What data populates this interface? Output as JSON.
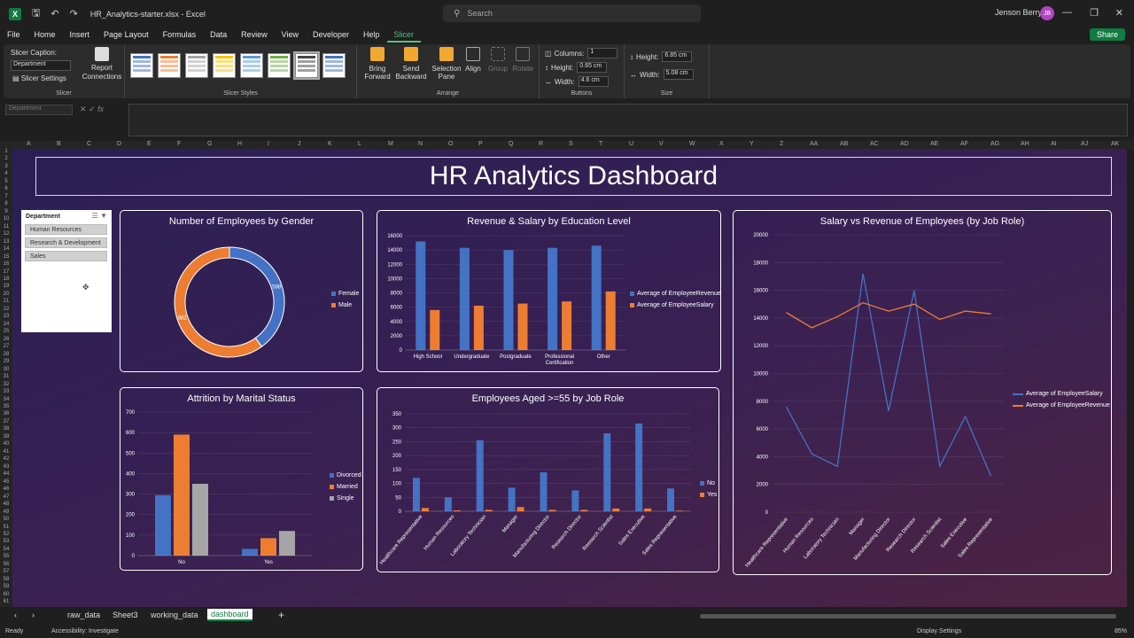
{
  "window": {
    "doc_title": "HR_Analytics-starter.xlsx  -  Excel",
    "search_placeholder": "Search",
    "user_name": "Jenson Berry",
    "user_initials": "JB"
  },
  "menu": [
    "File",
    "Home",
    "Insert",
    "Page Layout",
    "Formulas",
    "Data",
    "Review",
    "View",
    "Developer",
    "Help",
    "Slicer"
  ],
  "share_label": "Share",
  "ribbon": {
    "slicer_caption_label": "Slicer Caption:",
    "slicer_caption_value": "Department",
    "slicer_settings_label": "Slicer Settings",
    "report_connections_label": "Report Connections",
    "group_slicer": "Slicer",
    "group_styles": "Slicer Styles",
    "bring_forward": "Bring Forward",
    "send_backward": "Send Backward",
    "selection_pane": "Selection Pane",
    "align": "Align",
    "group": "Group",
    "rotate": "Rotate",
    "group_arrange": "Arrange",
    "columns_label": "Columns:",
    "columns_value": "1",
    "btn_height_label": "Height:",
    "btn_height_value": "0.65 cm",
    "btn_width_label": "Width:",
    "btn_width_value": "4.6 cm",
    "group_buttons": "Buttons",
    "size_height_label": "Height:",
    "size_height_value": "6.85 cm",
    "size_width_label": "Width:",
    "size_width_value": "5.08 cm",
    "group_size": "Size"
  },
  "formula": {
    "name_box": "Department",
    "fx": "fx"
  },
  "columns": [
    "A",
    "B",
    "C",
    "D",
    "E",
    "F",
    "G",
    "H",
    "I",
    "J",
    "K",
    "L",
    "M",
    "N",
    "O",
    "P",
    "Q",
    "R",
    "S",
    "T",
    "U",
    "V",
    "W",
    "X",
    "Y",
    "Z",
    "AA",
    "AB",
    "AC",
    "AD",
    "AE",
    "AF",
    "AG",
    "AH",
    "AI",
    "AJ",
    "AK"
  ],
  "dashboard": {
    "title": "HR Analytics Dashboard"
  },
  "slicer": {
    "title": "Department",
    "items": [
      "Human Resources",
      "Research & Development",
      "Sales"
    ]
  },
  "colors": {
    "blue": "#4472c4",
    "orange": "#ed7d31",
    "gray": "#a5a5a5",
    "excel_green": "#107c41"
  },
  "chart_data": [
    {
      "type": "pie",
      "title": "Number of Employees by Gender",
      "categories": [
        "Female",
        "Male"
      ],
      "values": [
        588,
        882
      ],
      "data_labels": [
        "588",
        "882"
      ]
    },
    {
      "type": "bar",
      "title": "Revenue & Salary by Education Level",
      "categories": [
        "High School",
        "Undergraduate",
        "Postgraduate",
        "Professional Certification",
        "Other"
      ],
      "series": [
        {
          "name": "Average of EmployeeRevenue",
          "values": [
            15200,
            14300,
            14000,
            14300,
            14600
          ]
        },
        {
          "name": "Average of EmployeeSalary",
          "values": [
            5600,
            6200,
            6500,
            6800,
            8200
          ]
        }
      ],
      "ylim": [
        0,
        16000
      ],
      "yticks": [
        "0",
        "2000",
        "4000",
        "6000",
        "8000",
        "10000",
        "12000",
        "14000",
        "16000"
      ]
    },
    {
      "type": "line",
      "title": "Salary vs Revenue of Employees (by Job Role)",
      "categories": [
        "Healthcare Representative",
        "Human Resources",
        "Laboratory Technician",
        "Manager",
        "Manufacturing Director",
        "Research Director",
        "Research Scientist",
        "Sales Executive",
        "Sales Representative"
      ],
      "series": [
        {
          "name": "Average of EmployeeSalary",
          "values": [
            7600,
            4200,
            3300,
            17200,
            7300,
            16000,
            3300,
            6900,
            2600
          ]
        },
        {
          "name": "Average of EmployeeRevenue",
          "values": [
            14400,
            13300,
            14100,
            15100,
            14500,
            15000,
            13900,
            14500,
            14300
          ]
        }
      ],
      "ylim": [
        0,
        20000
      ],
      "yticks": [
        "0",
        "2000",
        "4000",
        "6000",
        "8000",
        "10000",
        "12000",
        "14000",
        "16000",
        "18000",
        "20000"
      ]
    },
    {
      "type": "bar",
      "title": "Attrition by Marital Status",
      "categories": [
        "No",
        "Yes"
      ],
      "series": [
        {
          "name": "Divorced",
          "values": [
            295,
            33
          ]
        },
        {
          "name": "Married",
          "values": [
            590,
            85
          ]
        },
        {
          "name": "Single",
          "values": [
            350,
            120
          ]
        }
      ],
      "ylim": [
        0,
        700
      ],
      "yticks": [
        "0",
        "100",
        "200",
        "300",
        "400",
        "500",
        "600",
        "700"
      ]
    },
    {
      "type": "bar",
      "title": "Employees Aged >=55 by Job Role",
      "categories": [
        "Healthcare Representative",
        "Human Resources",
        "Laboratory Technician",
        "Manager",
        "Manufacturing Director",
        "Research Director",
        "Research Scientist",
        "Sales Executive",
        "Sales Representative"
      ],
      "series": [
        {
          "name": "No",
          "values": [
            120,
            50,
            255,
            85,
            140,
            75,
            280,
            315,
            82
          ]
        },
        {
          "name": "Yes",
          "values": [
            12,
            3,
            5,
            15,
            5,
            5,
            10,
            10,
            2
          ]
        }
      ],
      "ylim": [
        0,
        350
      ],
      "yticks": [
        "0",
        "50",
        "100",
        "150",
        "200",
        "250",
        "300",
        "350"
      ]
    }
  ],
  "sheet_tabs": [
    "raw_data",
    "Sheet3",
    "working_data",
    "dashboard"
  ],
  "status": {
    "ready": "Ready",
    "accessibility": "Accessibility: Investigate",
    "display_settings": "Display Settings",
    "zoom": "85%"
  }
}
